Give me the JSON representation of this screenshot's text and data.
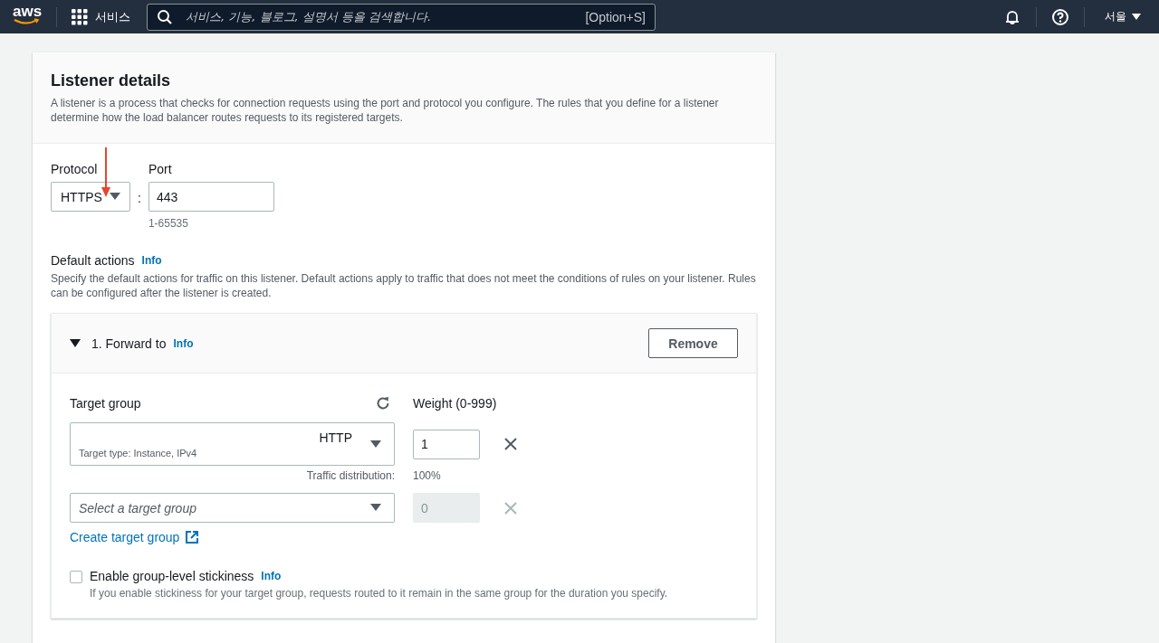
{
  "topbar": {
    "logo": "aws",
    "services": "서비스",
    "search": {
      "placeholder": "서비스, 기능, 블로그, 설명서 등을 검색합니다.",
      "shortcut": "[Option+S]"
    },
    "region": "서울"
  },
  "listener": {
    "title": "Listener details",
    "description": "A listener is a process that checks for connection requests using the port and protocol you configure. The rules that you define for a listener determine how the load balancer routes requests to its registered targets.",
    "protocol": {
      "label": "Protocol",
      "value": "HTTPS"
    },
    "separator": ":",
    "port": {
      "label": "Port",
      "value": "443",
      "hint": "1-65535"
    },
    "default_actions": {
      "label": "Default actions",
      "info": "Info",
      "description": "Specify the default actions for traffic on this listener. Default actions apply to traffic that does not meet the conditions of rules on your listener. Rules can be configured after the listener is created."
    },
    "action": {
      "title": "1. Forward to",
      "info": "Info",
      "expanded": true,
      "remove": "Remove",
      "target_group_label": "Target group",
      "weight_label": "Weight (0-999)",
      "groups": [
        {
          "value": "HTTP",
          "subtext": "Target type: Instance, IPv4",
          "weight": "1",
          "disabled": false,
          "distribution_label": "Traffic distribution:",
          "distribution": "100%"
        },
        {
          "placeholder": "Select a target group",
          "weight": "0",
          "disabled": true
        }
      ],
      "create_link": "Create target group",
      "stickiness": {
        "label": "Enable group-level stickiness",
        "info": "Info",
        "checked": false,
        "description": "If you enable stickiness for your target group, requests routed to it remain in the same group for the duration you specify."
      }
    }
  }
}
